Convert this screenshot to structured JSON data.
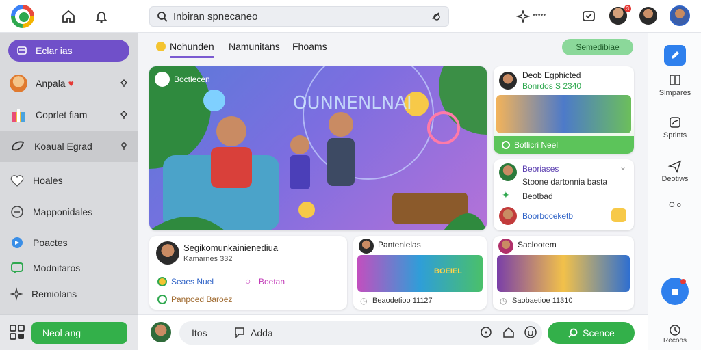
{
  "header": {
    "search_value": "Inbiran spnecaneo",
    "notif_count": "3",
    "top_right_label": "•••••"
  },
  "sidebar": {
    "items": [
      {
        "label": "Eclar ias",
        "icon": "inbox-icon"
      },
      {
        "label": "Anpala",
        "icon": "avatar-icon"
      },
      {
        "label": "Coprlet fiam",
        "icon": "gift-icon"
      },
      {
        "label": "Koaual Egrad",
        "icon": "leaf-icon"
      },
      {
        "label": "Hoales",
        "icon": "heart-icon"
      },
      {
        "label": "Mapponidales",
        "icon": "chat-icon"
      },
      {
        "label": "Poactes",
        "icon": "play-icon"
      },
      {
        "label": "Modnitaros",
        "icon": "message-icon"
      },
      {
        "label": "Remiolans",
        "icon": "sparkle-icon"
      }
    ],
    "next_button": "Neol ang"
  },
  "tabs": [
    {
      "label": "Nohunden"
    },
    {
      "label": "Namunitans"
    },
    {
      "label": "Fhoams"
    }
  ],
  "tab_action": "Semedibiae",
  "hero": {
    "chip_label": "Boctlecen",
    "banner_text": "OUNNENLNAI"
  },
  "card_r1": {
    "title": "Deob Egphicted",
    "subtitle": "Bonrdos S 2340",
    "footer": "Botlicri Neel"
  },
  "card_r2": {
    "title": "Beoriases",
    "line1": "Stoone dartonnia  basta",
    "line2": "Beotbad",
    "line3": "Boorboceketb"
  },
  "card_b1": {
    "title": "Segikomunkainienediua",
    "subtitle": "Kamarnes 332",
    "stat1": "Seaes Nuel",
    "stat2": "Boetan",
    "stat3": "Panpoed Baroez"
  },
  "card_b2": {
    "title": "Pantenlelas",
    "banner": "BOEIEL",
    "footer": "Beaodetioo 11127"
  },
  "card_b3": {
    "title": "Saclootem",
    "footer": "Saobaetioe 11310"
  },
  "rail": [
    {
      "label": ""
    },
    {
      "label": "Slmpares"
    },
    {
      "label": "Sprints"
    },
    {
      "label": "Deotiws"
    },
    {
      "label": "O o"
    }
  ],
  "rail_bottom": "Recoos",
  "composer": {
    "chip1": "Itos",
    "chip2": "Adda",
    "send_label": "Scence"
  },
  "colors": {
    "accent": "#7050c9",
    "green": "#33b04a",
    "blue": "#2f80ed"
  }
}
